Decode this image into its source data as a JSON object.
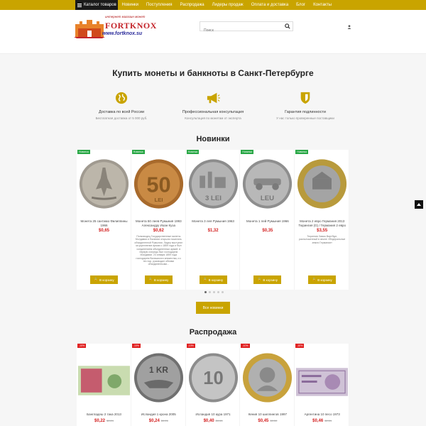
{
  "nav": {
    "catalog": "Каталог товаров",
    "links": [
      "Новинки",
      "Поступления",
      "Распродажа",
      "Лидеры продаж",
      "Оплата и доставка",
      "Блог",
      "Контакты"
    ]
  },
  "header": {
    "logo_sub": "интернет магазин монет",
    "logo_name": "FORTKNOX",
    "logo_url": "www.fortknox.su",
    "search_placeholder": "Поиск"
  },
  "hero": {
    "title": "Купить монеты и банкноты в Санкт-Петербурге",
    "features": [
      {
        "icon": "globe-icon",
        "title": "Доставка по всей России",
        "sub": "Бесплатная доставка от 5 000 руб."
      },
      {
        "icon": "megaphone-icon",
        "title": "Профессиональная консультация",
        "sub": "Консультация по монетам от эксперта"
      },
      {
        "icon": "shield-icon",
        "title": "Гарантия подлинности",
        "sub": "У нас только проверенные поставщики"
      }
    ]
  },
  "new_section": {
    "title": "Новинки",
    "badge": "Новинка",
    "cart_label": "В корзину",
    "all_label": "Все новинки",
    "products": [
      {
        "name": "Монета 25 сантимо Филиппины 1966",
        "price": "$0,65",
        "desc": ""
      },
      {
        "name": "Монета 50 леев Румыния 1993 Александру Иоан Куза",
        "price": "$0,62",
        "desc": "Полководец Государственные монеты Молдавии и Валахии открыли пожелать объединенной Румынии. Лидер выступил за укрепление армии с 1859 года и был соединением объединенных армий. в первую очередь был господарем Молдавии. 24 января 1859 года господарем Валашского княжества, и с тех пор, руководил обеими объединенными..."
      },
      {
        "name": "Монета 3 лея Румыния 1963",
        "price": "$1,32",
        "desc": ""
      },
      {
        "name": "Монета 1 лей Румыния 1966",
        "price": "$0,35",
        "desc": ""
      },
      {
        "name": "Монета 2 евро Германия 2013 Тюрингия (G) / Германия 2 евро",
        "price": "$3,55",
        "desc": "Тюрингия Замок Вартбург, расположенный в земле «Федеральные земли Германии»"
      }
    ]
  },
  "sale_section": {
    "title": "Распродажа",
    "products": [
      {
        "badge": "-10%",
        "name": "Бангладеш 2 така 2013",
        "price": "$0,22",
        "old": "$0,24"
      },
      {
        "badge": "-10%",
        "name": "Исландия 1 крона 2005",
        "price": "$0,24",
        "old": "$0,26"
      },
      {
        "badge": "-10%",
        "name": "Исландия 10 аура 1971",
        "price": "$0,40",
        "old": "$0,45"
      },
      {
        "badge": "-10%",
        "name": "Кения 10 шиллингов 1997",
        "price": "$0,45",
        "old": "$0,50"
      },
      {
        "badge": "-10%",
        "name": "Аргентина 10 песо 1973",
        "price": "$0,46",
        "old": "$0,51"
      }
    ]
  },
  "colors": {
    "accent": "#c9a400",
    "price": "#d32020",
    "new_badge": "#28a745",
    "sale_badge": "#e02020"
  }
}
